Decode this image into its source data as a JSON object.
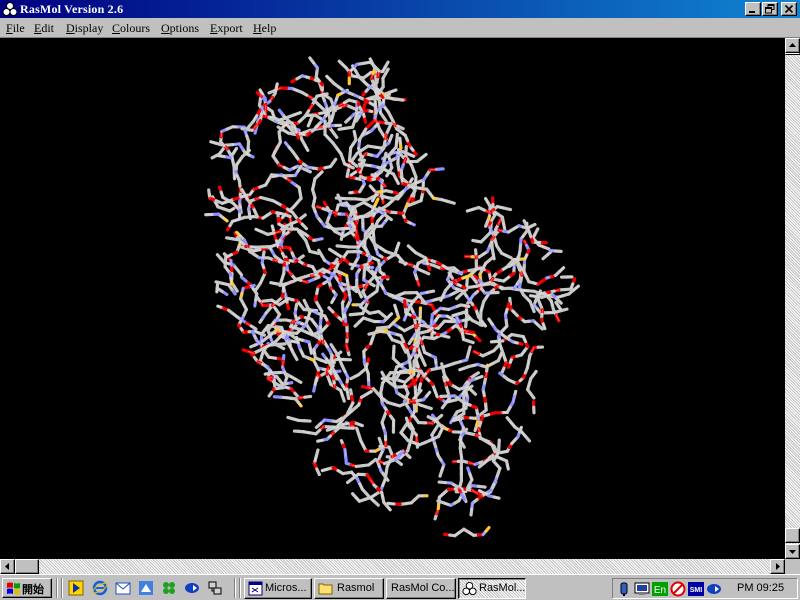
{
  "window": {
    "title": "RasMol Version 2.6",
    "app_icon": "rasmol-atoms-icon",
    "controls": [
      "minimize",
      "maximize",
      "close"
    ]
  },
  "menu": [
    {
      "label": "File"
    },
    {
      "label": "Edit"
    },
    {
      "label": "Display"
    },
    {
      "label": "Colours"
    },
    {
      "label": "Options"
    },
    {
      "label": "Export"
    },
    {
      "label": "Help"
    }
  ],
  "viewer": {
    "background": "#000000",
    "description_colors": {
      "carbon": "#c8c8c8",
      "oxygen": "#f00000",
      "nitrogen": "#8f8fff",
      "sulfur": "#ffc832"
    }
  },
  "taskbar": {
    "start_label": "開始",
    "quick_launch": [
      "media-player-icon",
      "internet-explorer-icon",
      "outlook-express-icon",
      "channels-icon",
      "clover-icon",
      "arrow-icon",
      "network-icon"
    ],
    "tasks": [
      {
        "label": "Micros...",
        "icon": "microsoft-window-icon",
        "active": false
      },
      {
        "label": "Rasmol",
        "icon": "folder-icon",
        "active": false
      },
      {
        "label": "RasMol Co...",
        "icon": "",
        "active": false
      },
      {
        "label": "RasMol...",
        "icon": "rasmol-atoms-icon",
        "active": true
      }
    ],
    "tray_icons": [
      "sound-icon",
      "monitor-icon",
      "keyboard-en-icon",
      "no-entry-icon",
      "app-badge-icon",
      "arrow-icon"
    ],
    "tray_badge_en": "En",
    "tray_badge_app": "SMI",
    "clock": "PM 09:25"
  }
}
